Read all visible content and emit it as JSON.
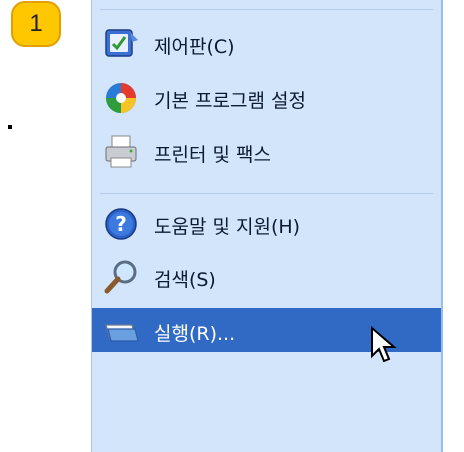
{
  "step_number": "1",
  "menu": {
    "items": [
      {
        "label": "제어판(C)",
        "icon": "control-panel-icon"
      },
      {
        "label": "기본 프로그램 설정",
        "icon": "default-programs-icon"
      },
      {
        "label": "프린터 및 팩스",
        "icon": "printer-fax-icon"
      },
      {
        "label": "도움말 및 지원(H)",
        "icon": "help-icon"
      },
      {
        "label": "검색(S)",
        "icon": "search-icon"
      },
      {
        "label": "실행(R)...",
        "icon": "run-icon",
        "selected": true
      }
    ]
  },
  "colors": {
    "panel_bg": "#d3e5fa",
    "selection_bg": "#316ac5",
    "badge_fill": "#ffc700"
  }
}
